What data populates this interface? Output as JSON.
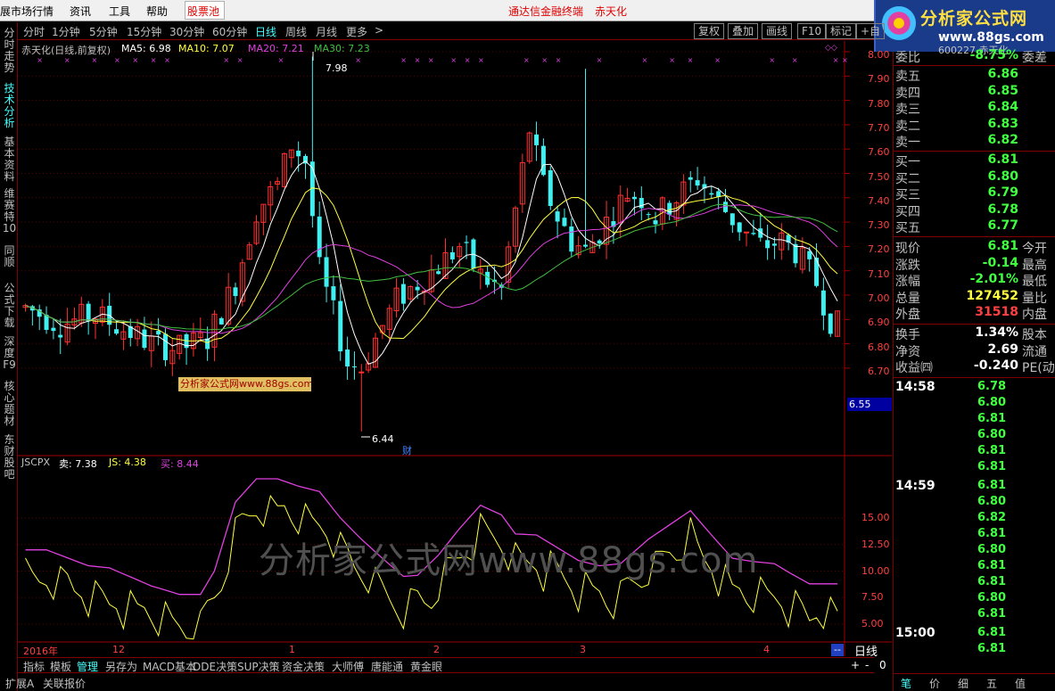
{
  "menu": {
    "items": [
      "展市场行情",
      "资讯",
      "工具",
      "帮助"
    ],
    "pool": "股票池",
    "center_title": "通达信金融终端",
    "stock_name_red": "赤天化"
  },
  "logo": {
    "title": "分析家公式网",
    "url": "www.88gs.com"
  },
  "sidebar": {
    "tabs": [
      "分时走势",
      "技术分析",
      "基本资料",
      "维赛特10",
      "同顺",
      "公式下载",
      "深度F9",
      "核心题材",
      "东财股吧"
    ]
  },
  "toolbar": {
    "periods": [
      "分时",
      "1分钟",
      "5分钟",
      "15分钟",
      "30分钟",
      "60分钟",
      "日线",
      "周线",
      "月线",
      "更多"
    ],
    "more_arrow": ">",
    "buttons": [
      "复权",
      "叠加",
      "画线",
      "F10",
      "标记",
      "+自"
    ]
  },
  "main_chart": {
    "title": "赤天化(日线,前复权)",
    "ma5": "MA5: 6.98",
    "ma10": "MA10: 7.07",
    "ma20": "MA20: 7.21",
    "ma30": "MA30: 7.23",
    "high_label": "7.98",
    "low_label": "6.44",
    "cai_marker": "财",
    "y_ticks": [
      "8.00",
      "7.90",
      "7.80",
      "7.70",
      "7.60",
      "7.50",
      "7.40",
      "7.30",
      "7.20",
      "7.10",
      "7.00",
      "6.90",
      "6.80",
      "6.70"
    ],
    "current_price_tag": "6.55",
    "colors": {
      "up": "#ff3030",
      "down": "#40f0f0",
      "ma5": "#ffffff",
      "ma10": "#ffff40",
      "ma20": "#e040e0",
      "ma30": "#40c040"
    }
  },
  "tip_box": "分析家公式网www.88gs.com",
  "indicator": {
    "name": "JSCPX",
    "sell": "卖: 7.38",
    "js": "JS: 4.38",
    "buy": "买: 8.44",
    "y_ticks": [
      "15.00",
      "12.50",
      "10.00",
      "7.50",
      "5.00"
    ]
  },
  "watermark": "分析家公式网www.88gs.com",
  "x_axis": {
    "labels": [
      "2016年",
      "12",
      "1",
      "2",
      "3",
      "4"
    ],
    "period_box": "日线",
    "minus_box": "--"
  },
  "bottom_tabs": [
    "指标",
    "模板",
    "管理",
    "另存为",
    "MACD基本",
    "DDE决策",
    "SUP决策",
    "资金决策",
    "大师傅",
    "唐能通",
    "黄金眼"
  ],
  "bottom_bar2": [
    "扩展A",
    "关联报价"
  ],
  "zoom_controls": [
    "+",
    "-",
    "0"
  ],
  "quote_panel": {
    "header_code": "600227 赤天化",
    "weibi": {
      "label": "委比",
      "value": "-8.75%",
      "right": "委差"
    },
    "sells": [
      {
        "label": "卖五",
        "price": "6.86"
      },
      {
        "label": "卖四",
        "price": "6.85"
      },
      {
        "label": "卖三",
        "price": "6.84"
      },
      {
        "label": "卖二",
        "price": "6.83"
      },
      {
        "label": "卖一",
        "price": "6.82"
      }
    ],
    "buys": [
      {
        "label": "买一",
        "price": "6.81"
      },
      {
        "label": "买二",
        "price": "6.80"
      },
      {
        "label": "买三",
        "price": "6.79"
      },
      {
        "label": "买四",
        "price": "6.78"
      },
      {
        "label": "买五",
        "price": "6.77"
      }
    ],
    "stats": [
      {
        "label": "现价",
        "value": "6.81",
        "right": "今开",
        "color": "#40ff40"
      },
      {
        "label": "涨跌",
        "value": "-0.14",
        "right": "最高",
        "color": "#40ff40"
      },
      {
        "label": "涨幅",
        "value": "-2.01%",
        "right": "最低",
        "color": "#40ff40"
      },
      {
        "label": "总量",
        "value": "127452",
        "right": "量比",
        "color": "#ffff40"
      },
      {
        "label": "外盘",
        "value": "31518",
        "right": "内盘",
        "color": "#ff4040"
      }
    ],
    "stats2": [
      {
        "label": "换手",
        "value": "1.34%",
        "right": "股本"
      },
      {
        "label": "净资",
        "value": "2.69",
        "right": "流通"
      },
      {
        "label": "收益㈣",
        "value": "-0.240",
        "right": "PE(动)"
      }
    ],
    "ticks": [
      {
        "time": "14:58",
        "prices": [
          "6.78",
          "6.80",
          "6.81",
          "6.80",
          "6.81",
          "6.81"
        ]
      },
      {
        "time": "14:59",
        "prices": [
          "6.81",
          "6.80",
          "6.82",
          "6.81",
          "6.80",
          "6.81",
          "6.81",
          "6.80",
          "6.81"
        ]
      },
      {
        "time": "15:00",
        "prices": [
          "6.81",
          "6.81"
        ]
      }
    ],
    "footer_tabs": [
      "笔",
      "价",
      "细",
      "五",
      "值"
    ]
  }
}
